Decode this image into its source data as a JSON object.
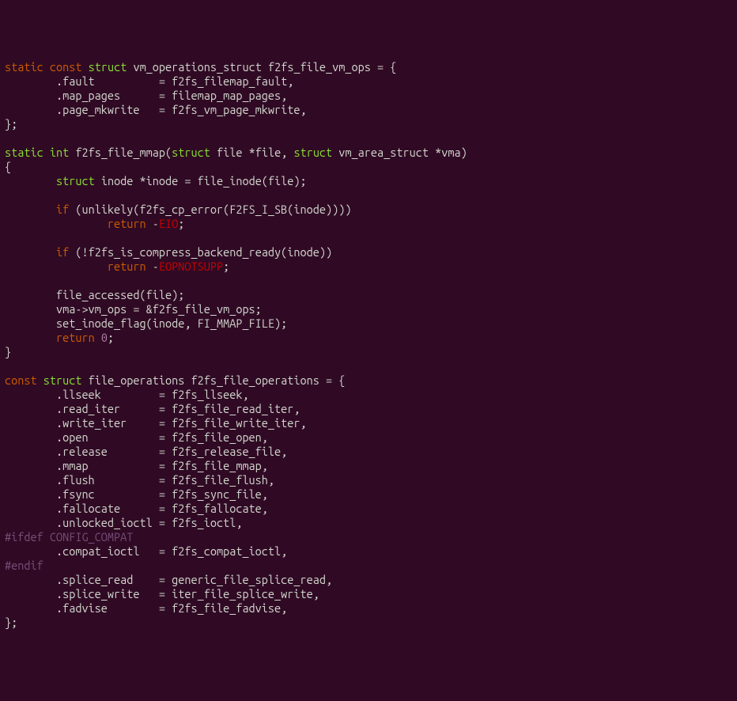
{
  "code": {
    "tokens": [
      {
        "text": "static",
        "class": "kw-orange"
      },
      {
        "text": " ",
        "class": "fg"
      },
      {
        "text": "const",
        "class": "kw-orange"
      },
      {
        "text": " ",
        "class": "fg"
      },
      {
        "text": "struct",
        "class": "kw-green"
      },
      {
        "text": " vm_operations_struct f2fs_file_vm_ops = {\n",
        "class": "fg"
      },
      {
        "text": "        .fault          = f2fs_filemap_fault,\n",
        "class": "fg"
      },
      {
        "text": "        .map_pages      = filemap_map_pages,\n",
        "class": "fg"
      },
      {
        "text": "        .page_mkwrite   = f2fs_vm_page_mkwrite,\n",
        "class": "fg"
      },
      {
        "text": "};\n",
        "class": "fg"
      },
      {
        "text": "\n",
        "class": "fg"
      },
      {
        "text": "static",
        "class": "kw-green"
      },
      {
        "text": " ",
        "class": "fg"
      },
      {
        "text": "int",
        "class": "kw-green"
      },
      {
        "text": " f2fs_file_mmap(",
        "class": "fg"
      },
      {
        "text": "struct",
        "class": "kw-green"
      },
      {
        "text": " file *file, ",
        "class": "fg"
      },
      {
        "text": "struct",
        "class": "kw-green"
      },
      {
        "text": " vm_area_struct *vma)\n",
        "class": "fg"
      },
      {
        "text": "{\n",
        "class": "fg"
      },
      {
        "text": "        ",
        "class": "fg"
      },
      {
        "text": "struct",
        "class": "kw-green"
      },
      {
        "text": " inode *inode = file_inode(file);\n",
        "class": "fg"
      },
      {
        "text": "\n",
        "class": "fg"
      },
      {
        "text": "        ",
        "class": "fg"
      },
      {
        "text": "if",
        "class": "kw-orange"
      },
      {
        "text": " (unlikely(f2fs_cp_error(F2FS_I_SB(inode))))\n",
        "class": "fg"
      },
      {
        "text": "                ",
        "class": "fg"
      },
      {
        "text": "return",
        "class": "kw-orange"
      },
      {
        "text": " -",
        "class": "fg"
      },
      {
        "text": "EIO",
        "class": "kw-red"
      },
      {
        "text": ";\n",
        "class": "fg"
      },
      {
        "text": "\n",
        "class": "fg"
      },
      {
        "text": "        ",
        "class": "fg"
      },
      {
        "text": "if",
        "class": "kw-orange"
      },
      {
        "text": " (!f2fs_is_compress_backend_ready(inode))\n",
        "class": "fg"
      },
      {
        "text": "                ",
        "class": "fg"
      },
      {
        "text": "return",
        "class": "kw-orange"
      },
      {
        "text": " -",
        "class": "fg"
      },
      {
        "text": "EOPNOTSUPP",
        "class": "kw-red"
      },
      {
        "text": ";\n",
        "class": "fg"
      },
      {
        "text": "\n",
        "class": "fg"
      },
      {
        "text": "        file_accessed(file);\n",
        "class": "fg"
      },
      {
        "text": "        vma->vm_ops = &f2fs_file_vm_ops;\n",
        "class": "fg"
      },
      {
        "text": "        set_inode_flag(inode, FI_MMAP_FILE);\n",
        "class": "fg"
      },
      {
        "text": "        ",
        "class": "fg"
      },
      {
        "text": "return",
        "class": "kw-orange"
      },
      {
        "text": " ",
        "class": "fg"
      },
      {
        "text": "0",
        "class": "num"
      },
      {
        "text": ";\n",
        "class": "fg"
      },
      {
        "text": "}\n",
        "class": "fg"
      },
      {
        "text": "\n",
        "class": "fg"
      },
      {
        "text": "const",
        "class": "kw-orange"
      },
      {
        "text": " ",
        "class": "fg"
      },
      {
        "text": "struct",
        "class": "kw-green"
      },
      {
        "text": " file_operations f2fs_file_operations = {\n",
        "class": "fg"
      },
      {
        "text": "        .llseek         = f2fs_llseek,\n",
        "class": "fg"
      },
      {
        "text": "        .read_iter      = f2fs_file_read_iter,\n",
        "class": "fg"
      },
      {
        "text": "        .write_iter     = f2fs_file_write_iter,\n",
        "class": "fg"
      },
      {
        "text": "        .open           = f2fs_file_open,\n",
        "class": "fg"
      },
      {
        "text": "        .release        = f2fs_release_file,\n",
        "class": "fg"
      },
      {
        "text": "        .mmap           = f2fs_file_mmap,\n",
        "class": "fg"
      },
      {
        "text": "        .flush          = f2fs_file_flush,\n",
        "class": "fg"
      },
      {
        "text": "        .fsync          = f2fs_sync_file,\n",
        "class": "fg"
      },
      {
        "text": "        .fallocate      = f2fs_fallocate,\n",
        "class": "fg"
      },
      {
        "text": "        .unlocked_ioctl = f2fs_ioctl,\n",
        "class": "fg"
      },
      {
        "text": "#ifdef CONFIG_COMPAT\n",
        "class": "preproc"
      },
      {
        "text": "        .compat_ioctl   = f2fs_compat_ioctl,\n",
        "class": "fg"
      },
      {
        "text": "#endif\n",
        "class": "preproc"
      },
      {
        "text": "        .splice_read    = generic_file_splice_read,\n",
        "class": "fg"
      },
      {
        "text": "        .splice_write   = iter_file_splice_write,\n",
        "class": "fg"
      },
      {
        "text": "        .fadvise        = f2fs_file_fadvise,\n",
        "class": "fg"
      },
      {
        "text": "};",
        "class": "fg"
      }
    ]
  }
}
